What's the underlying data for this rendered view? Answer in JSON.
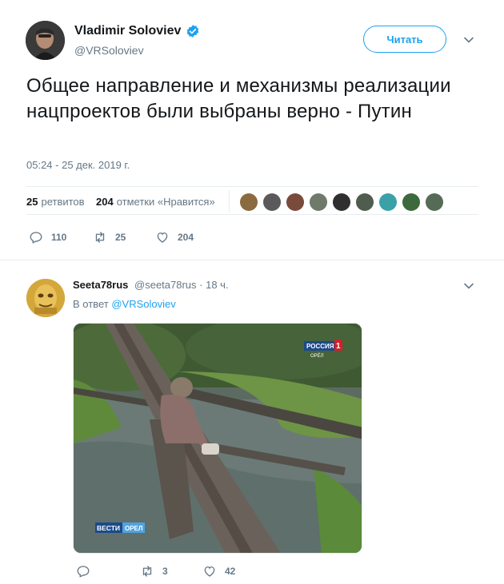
{
  "main_tweet": {
    "author_name": "Vladimir Soloviev",
    "author_handle": "@VRSoloviev",
    "follow_label": "Читать",
    "text": "Общее направление и механизмы реализации нацпроектов были выбраны верно - Путин",
    "timestamp": "05:24 - 25 дек. 2019 г.",
    "retweets_count": "25",
    "retweets_label": "ретвитов",
    "likes_count": "204",
    "likes_label": "отметки «Нравится»",
    "actions": {
      "replies": "110",
      "retweets": "25",
      "likes": "204"
    }
  },
  "reply_tweet": {
    "author_name": "Seeta78rus",
    "author_handle": "@seeta78rus",
    "time": "· 18 ч.",
    "reply_prefix": "В ответ",
    "reply_handle": "@VRSoloviev",
    "photo_logo_top": "РОССИЯ",
    "photo_logo_num": "1",
    "photo_logo_sub": "ОРЁЛ",
    "photo_logo_bottom": "ВЕСТИ",
    "photo_logo_bottom_sub": "ОРЕЛ",
    "actions": {
      "replies": "",
      "retweets": "3",
      "likes": "42"
    }
  },
  "colors": {
    "accent": "#1da1f2",
    "text_primary": "#14171a",
    "text_secondary": "#657786",
    "divider": "#e6ecf0"
  },
  "icons": [
    "verified-badge-icon",
    "chevron-down-icon",
    "reply-icon",
    "retweet-icon",
    "like-icon"
  ]
}
